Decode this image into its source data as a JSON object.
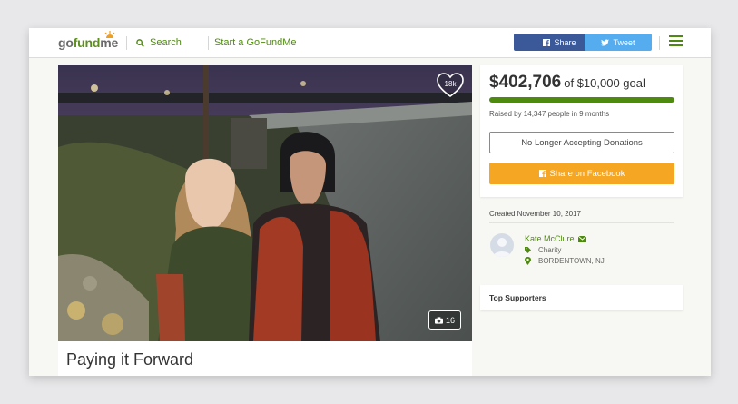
{
  "header": {
    "logo_go": "go",
    "logo_fund": "fund",
    "logo_me": "me",
    "search_label": "Search",
    "start_label": "Start a GoFundMe",
    "share_label": "Share",
    "tweet_label": "Tweet"
  },
  "photo": {
    "likes": "18k",
    "photo_count": "16"
  },
  "campaign": {
    "title": "Paying it Forward"
  },
  "donate": {
    "amount": "$402,706",
    "goal": "of $10,000 goal",
    "progress_fraction": 1.0,
    "raised_by": "Raised by 14,347 people in 9 months",
    "no_longer": "No Longer Accepting Donations",
    "share_fb": "Share on Facebook"
  },
  "organizer": {
    "created": "Created November 10, 2017",
    "name": "Kate McClure",
    "category": "Charity",
    "location": "BORDENTOWN, NJ"
  },
  "top_supporters": "Top Supporters",
  "colors": {
    "brand_green": "#4f8a10",
    "facebook": "#3b5998",
    "twitter": "#55acee",
    "accent_orange": "#f5a623"
  }
}
